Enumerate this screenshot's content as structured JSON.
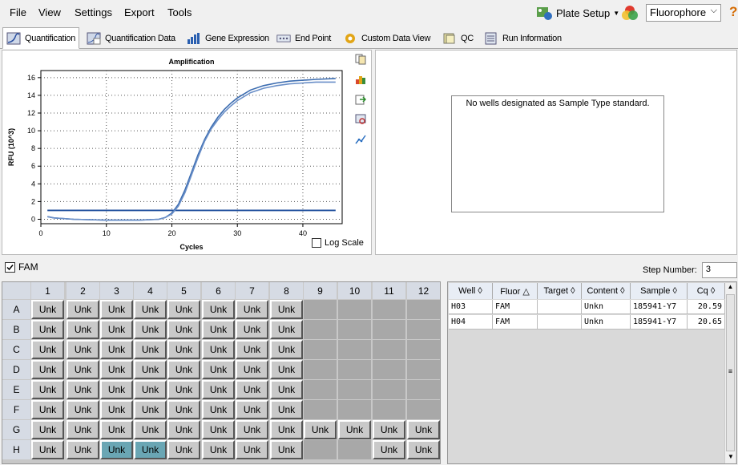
{
  "menu": [
    "File",
    "View",
    "Settings",
    "Export",
    "Tools"
  ],
  "toolbar": {
    "plate_setup": "Plate Setup",
    "fluorophore": "Fluorophore"
  },
  "tabs": [
    "Quantification",
    "Quantification Data",
    "Gene Expression",
    "End Point",
    "Custom Data View",
    "QC",
    "Run Information"
  ],
  "std_message": "No wells designated as Sample Type standard.",
  "log_scale": "Log Scale",
  "fam_label": "FAM",
  "step": {
    "label": "Step Number:",
    "value": "3"
  },
  "plate": {
    "cols": [
      "1",
      "2",
      "3",
      "4",
      "5",
      "6",
      "7",
      "8",
      "9",
      "10",
      "11",
      "12"
    ],
    "rows": [
      "A",
      "B",
      "C",
      "D",
      "E",
      "F",
      "G",
      "H"
    ],
    "unk_label": "Unk"
  },
  "well_table": {
    "headers": [
      "Well",
      "Fluor",
      "Target",
      "Content",
      "Sample",
      "Cq"
    ],
    "rows": [
      [
        "H03",
        "FAM",
        "",
        "Unkn",
        "185941-Y7",
        "20.59"
      ],
      [
        "H04",
        "FAM",
        "",
        "Unkn",
        "185941-Y7",
        "20.65"
      ]
    ]
  },
  "chart_data": {
    "type": "line",
    "title": "Amplification",
    "xlabel": "Cycles",
    "ylabel": "RFU (10^3)",
    "xlim": [
      0,
      46
    ],
    "ylim": [
      -0.5,
      16.8
    ],
    "xticks": [
      0,
      10,
      20,
      30,
      40
    ],
    "yticks": [
      0,
      2,
      4,
      6,
      8,
      10,
      12,
      14,
      16
    ],
    "grid": true,
    "threshold": 1.0,
    "series": [
      {
        "x": [
          1,
          2,
          5,
          10,
          15,
          18,
          19,
          20,
          21,
          22,
          23,
          24,
          25,
          26,
          27,
          28,
          29,
          30,
          32,
          34,
          36,
          38,
          40,
          42,
          45
        ],
        "y": [
          0.3,
          0.15,
          0.0,
          -0.1,
          -0.1,
          0.0,
          0.2,
          0.7,
          1.7,
          3.3,
          5.3,
          7.3,
          9.0,
          10.4,
          11.5,
          12.4,
          13.1,
          13.7,
          14.6,
          15.1,
          15.4,
          15.6,
          15.7,
          15.8,
          15.9
        ]
      },
      {
        "x": [
          1,
          2,
          5,
          10,
          15,
          18,
          19,
          20,
          21,
          22,
          23,
          24,
          25,
          26,
          27,
          28,
          29,
          30,
          32,
          34,
          36,
          38,
          40,
          42,
          45
        ],
        "y": [
          0.3,
          0.15,
          0.0,
          -0.1,
          -0.1,
          0.0,
          0.2,
          0.6,
          1.5,
          3.0,
          5.0,
          7.0,
          8.8,
          10.2,
          11.2,
          12.1,
          12.8,
          13.4,
          14.3,
          14.8,
          15.1,
          15.3,
          15.4,
          15.5,
          15.5
        ]
      }
    ]
  }
}
